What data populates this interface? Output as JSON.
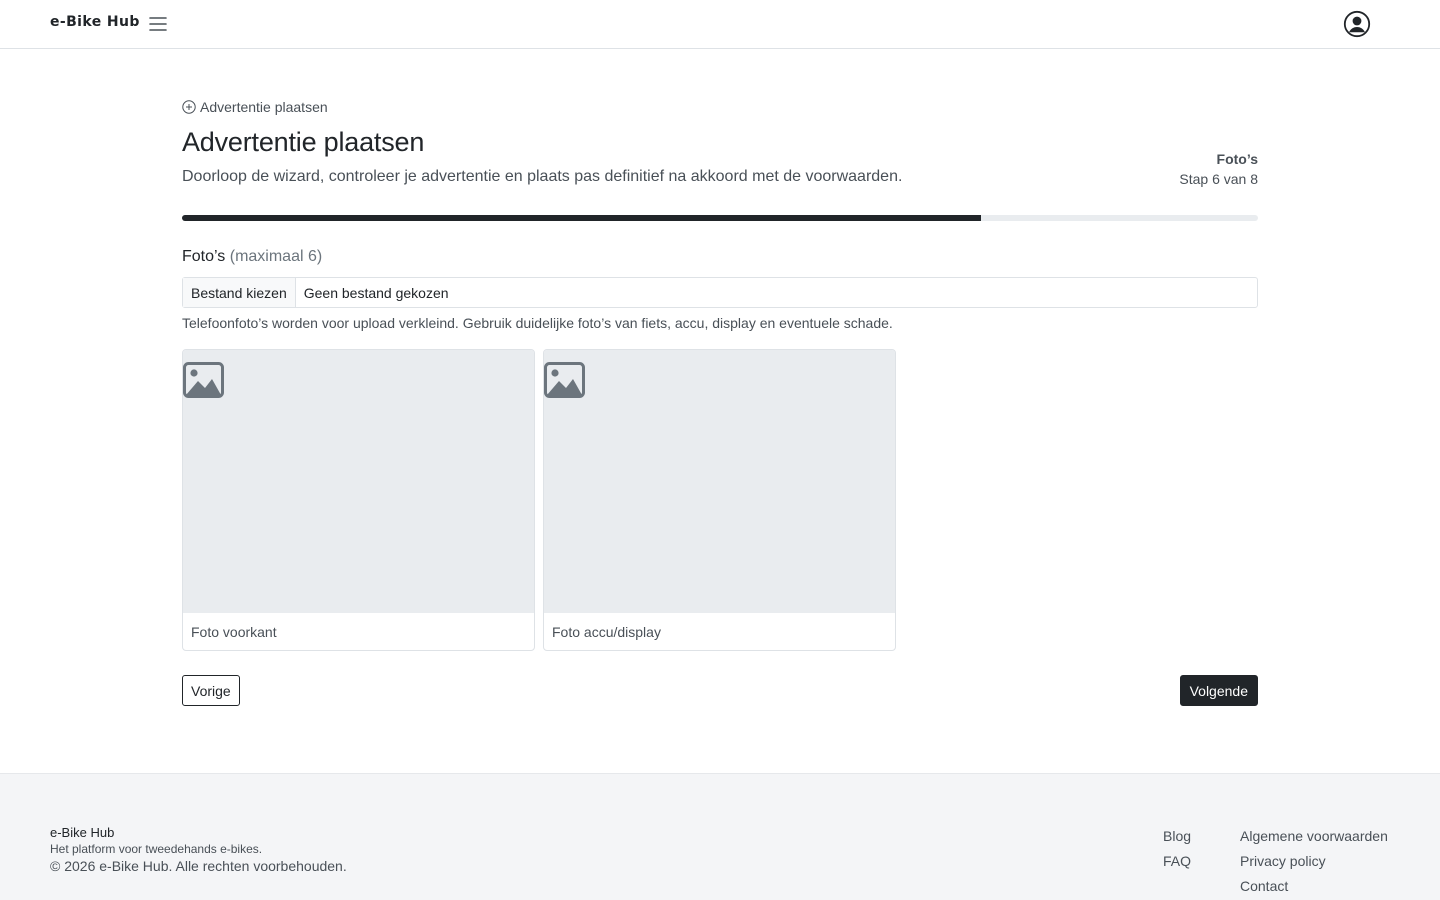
{
  "header": {
    "brand": "e-Bike Hub"
  },
  "breadcrumb": {
    "label": "Advertentie plaatsen"
  },
  "page": {
    "title": "Advertentie plaatsen",
    "lead": "Doorloop de wizard, controleer je advertentie en plaats pas definitief na akkoord met de voorwaarden."
  },
  "step": {
    "name": "Foto’s",
    "count": "Stap 6 van 8",
    "progress_percent": 74.3
  },
  "photos": {
    "label": "Foto’s",
    "label_hint": "(maximaal 6)",
    "file_button": "Bestand kiezen",
    "file_status": "Geen bestand gekozen",
    "help": "Telefoonfoto’s worden voor upload verkleind. Gebruik duidelijke foto’s van fiets, accu, display en eventuele schade.",
    "cards": [
      {
        "caption": "Foto voorkant",
        "icon": "image-placeholder-icon"
      },
      {
        "caption": "Foto accu/display",
        "icon": "image-placeholder-icon"
      }
    ]
  },
  "nav": {
    "prev": "Vorige",
    "next": "Volgende"
  },
  "footer": {
    "brand": "e-Bike Hub",
    "tagline": "Het platform voor tweedehands e-bikes.",
    "copyright": "© 2026 e-Bike Hub. Alle rechten voorbehouden.",
    "col1": [
      "Blog",
      "FAQ"
    ],
    "col2": [
      "Algemene voorwaarden",
      "Privacy policy",
      "Contact"
    ]
  },
  "colors": {
    "primary": "#212529",
    "muted": "#6c757d",
    "placeholder_bg": "#e9ecef",
    "footer_bg": "#f4f5f7"
  }
}
